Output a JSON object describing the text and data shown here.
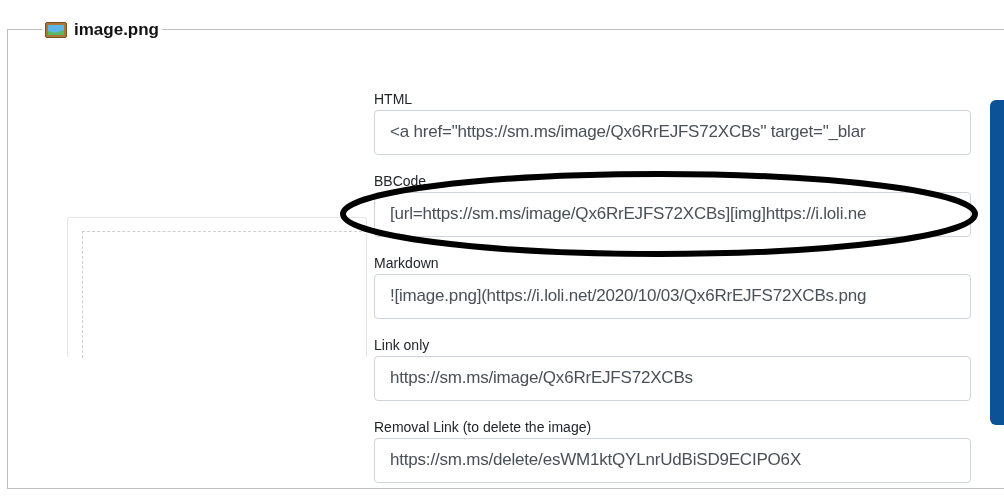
{
  "panel": {
    "title": "image.png"
  },
  "fields": [
    {
      "label": "HTML",
      "value": "<a href=\"https://sm.ms/image/Qx6RrEJFS72XCBs\" target=\"_blar",
      "highlighted": false
    },
    {
      "label": "BBCode",
      "value": "[url=https://sm.ms/image/Qx6RrEJFS72XCBs][img]https://i.loli.ne",
      "highlighted": true
    },
    {
      "label": "Markdown",
      "value": "![image.png](https://i.loli.net/2020/10/03/Qx6RrEJFS72XCBs.png",
      "highlighted": false
    },
    {
      "label": "Link only",
      "value": "https://sm.ms/image/Qx6RrEJFS72XCBs",
      "highlighted": false
    },
    {
      "label": "Removal Link (to delete the image)",
      "value": "https://sm.ms/delete/esWM1ktQYLnrUdBiSD9ECIPO6X",
      "highlighted": false
    }
  ]
}
